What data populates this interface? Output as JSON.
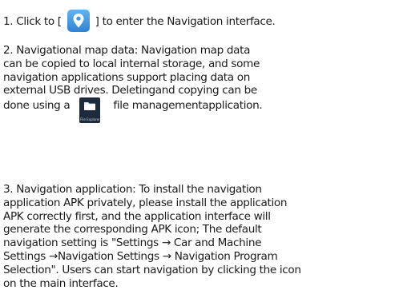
{
  "p1": {
    "before": "1. Click to [ ",
    "after": " ] to enter the Navigation interface."
  },
  "p2": {
    "l1": "2. Navigational map data: Navigation map data",
    "l2": "can be copied to local internal storage, and some",
    "l3": "navigation applications support placing data on",
    "l4": "external USB drives. Deletingand copying can be",
    "l5a": "done using a",
    "l5b": "file managementapplication.",
    "icon_caption": "File Explorer"
  },
  "p3": {
    "l1": "3. Navigation application: To install the navigation",
    "l2": "application APK privately, please install the application",
    "l3": "APK correctly first, and the application interface will",
    "l4": "generate the corresponding APK icon; The default",
    "l5": "navigation setting is \"Settings → Car and Machine",
    "l6": "Settings →Navigation Settings → Navigation Program",
    "l7": "Selection\". Users can start navigation by clicking the icon",
    "l8": "on the main interface."
  },
  "icons": {
    "navigation": "location-pin-icon",
    "file_manager": "folder-icon"
  },
  "colors": {
    "text": "#1a1a1a",
    "nav_icon": "#3f95e0",
    "file_icon_bg": "#1d2a3c"
  }
}
